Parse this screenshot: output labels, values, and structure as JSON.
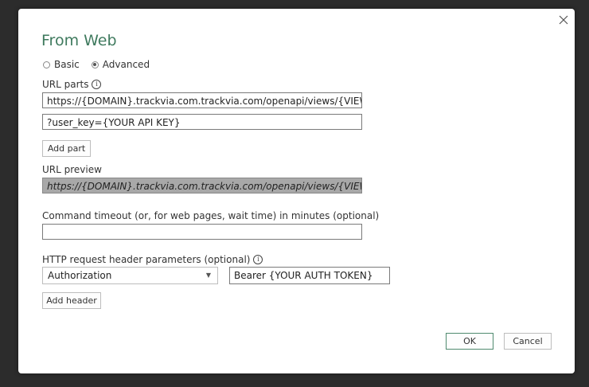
{
  "dialog": {
    "title": "From Web",
    "close_glyph": "close-icon"
  },
  "mode": {
    "basic_label": "Basic",
    "advanced_label": "Advanced",
    "selected": "Advanced"
  },
  "url_parts": {
    "label": "URL parts",
    "parts": [
      "https://{DOMAIN}.trackvia.com.trackvia.com/openapi/views/{VIEW ID}",
      "?user_key={YOUR API KEY}"
    ],
    "add_part_label": "Add part"
  },
  "url_preview": {
    "label": "URL preview",
    "value": "https://{DOMAIN}.trackvia.com.trackvia.com/openapi/views/{VIEW ID}?user_key={YOUR API KEY}"
  },
  "command_timeout": {
    "label": "Command timeout (or, for web pages, wait time) in minutes (optional)",
    "value": ""
  },
  "http_headers": {
    "label": "HTTP request header parameters (optional)",
    "header_name": "Authorization",
    "header_value": "Bearer {YOUR AUTH TOKEN}",
    "add_header_label": "Add header"
  },
  "footer": {
    "ok_label": "OK",
    "cancel_label": "Cancel"
  },
  "colors": {
    "title": "#3f7a5e",
    "primary_border": "#4f8a6f",
    "preview_bg": "#a8a8a8",
    "backdrop": "#2c2c2c"
  }
}
